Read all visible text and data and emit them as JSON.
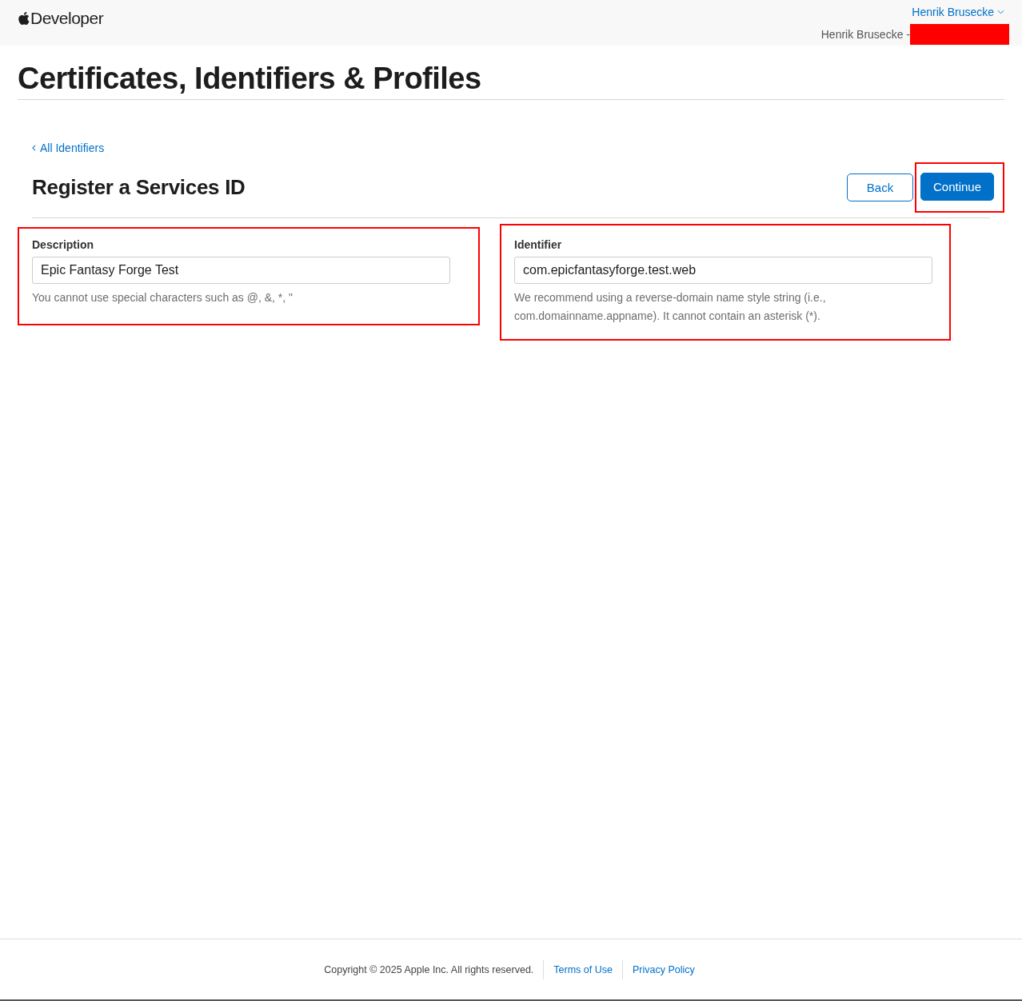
{
  "header": {
    "logo_text": "Developer",
    "account_menu": "Henrik Brusecke",
    "team_label": "Henrik Brusecke -",
    "team_redacted": true
  },
  "page_title": "Certificates, Identifiers & Profiles",
  "back_link": "All Identifiers",
  "heading": "Register a Services ID",
  "buttons": [
    {
      "label": "Back",
      "kind": "secondary",
      "highlighted": false
    },
    {
      "label": "Continue",
      "kind": "primary",
      "highlighted": true
    }
  ],
  "fields": [
    {
      "label": "Description",
      "value": "Epic Fantasy Forge Test",
      "hint": "You cannot use special characters such as @, &, *, \"",
      "highlighted": true
    },
    {
      "label": "Identifier",
      "value": "com.epicfantasyforge.test.web",
      "hint": "We recommend using a reverse-domain name style string (i.e., com.domainname.appname). It cannot contain an asterisk (*).",
      "highlighted": true
    }
  ],
  "footer": {
    "copyright": "Copyright © 2025 Apple Inc. All rights reserved.",
    "links": [
      "Terms of Use",
      "Privacy Policy"
    ]
  }
}
